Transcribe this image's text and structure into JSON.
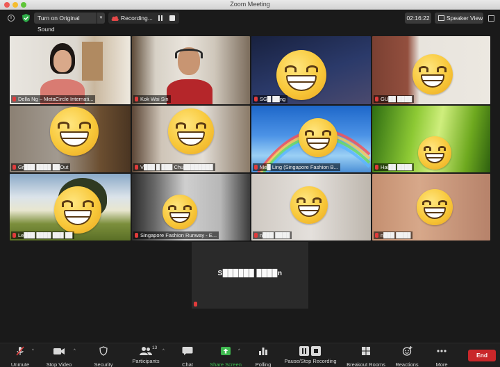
{
  "window": {
    "title": "Zoom Meeting"
  },
  "topbar": {
    "info_icon": "info-icon",
    "security_icon": "shield-check-icon",
    "original_sound_label": "Turn on Original Sound",
    "recording_label": "Recording...",
    "timer": "02:16:22",
    "view_label": "Speaker View"
  },
  "participants": [
    {
      "name": "Della Ng – MetaCircle Internati...",
      "active": true
    },
    {
      "name": "Kok Wai Sin"
    },
    {
      "name": "SG█ ██ng"
    },
    {
      "name": "GU██ ████"
    },
    {
      "name": "Gr███ ████ ██Out"
    },
    {
      "name": "V███ █ ███ Chu████████"
    },
    {
      "name": "Me█ Ling (Singapore Fashion B..."
    },
    {
      "name": "Hai██ ████"
    },
    {
      "name": "Le███ ████ ███ ██"
    },
    {
      "name": "Singapore Fashion Runway - E..."
    },
    {
      "name": "n███ ████"
    },
    {
      "name": "n███ ████"
    }
  ],
  "speaker_tile": {
    "name": "S██████ ████n"
  },
  "toolbar": {
    "unmute": "Unmute",
    "stop_video": "Stop Video",
    "security": "Security",
    "participants": "Participants",
    "participants_count": "13",
    "chat": "Chat",
    "share_screen": "Share Screen",
    "polling": "Polling",
    "pause_stop_recording": "Pause/Stop Recording",
    "breakout_rooms": "Breakout Rooms",
    "reactions": "Reactions",
    "more": "More",
    "end": "End"
  },
  "colors": {
    "active_border": "#c9d64a",
    "share_green": "#3fb950",
    "end_red": "#c9272a",
    "mute_red": "#e03b3b"
  }
}
